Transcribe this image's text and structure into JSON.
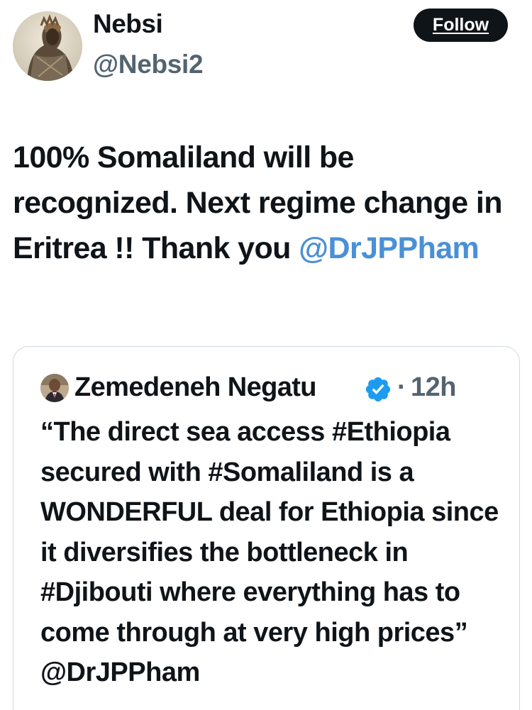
{
  "author": {
    "display_name": "Nebsi",
    "handle": "@Nebsi2",
    "follow_label": "Follow"
  },
  "tweet": {
    "text": "100% Somaliland will be recognized. Next regime change in Eritrea !! Thank you",
    "mention": "@DrJPPham"
  },
  "quoted_tweet": {
    "display_name": "Zemedeneh Negatu",
    "verified": true,
    "separator": "·",
    "time": "12h",
    "text": "“The direct sea access #Ethiopia secured with #Somaliland is a WONDERFUL deal for Ethiopia since it diversifies the bottleneck in #Djibouti where everything has to come through at very",
    "truncated_tail": "high prices” @DrJPPham"
  },
  "icons": {
    "verified": "verified-badge-icon"
  },
  "colors": {
    "text": "#0f1419",
    "secondary": "#536471",
    "link": "#4a90d6",
    "verified": "#1d9bf0",
    "follow_bg": "#0f1419",
    "border": "#cfd9de"
  }
}
